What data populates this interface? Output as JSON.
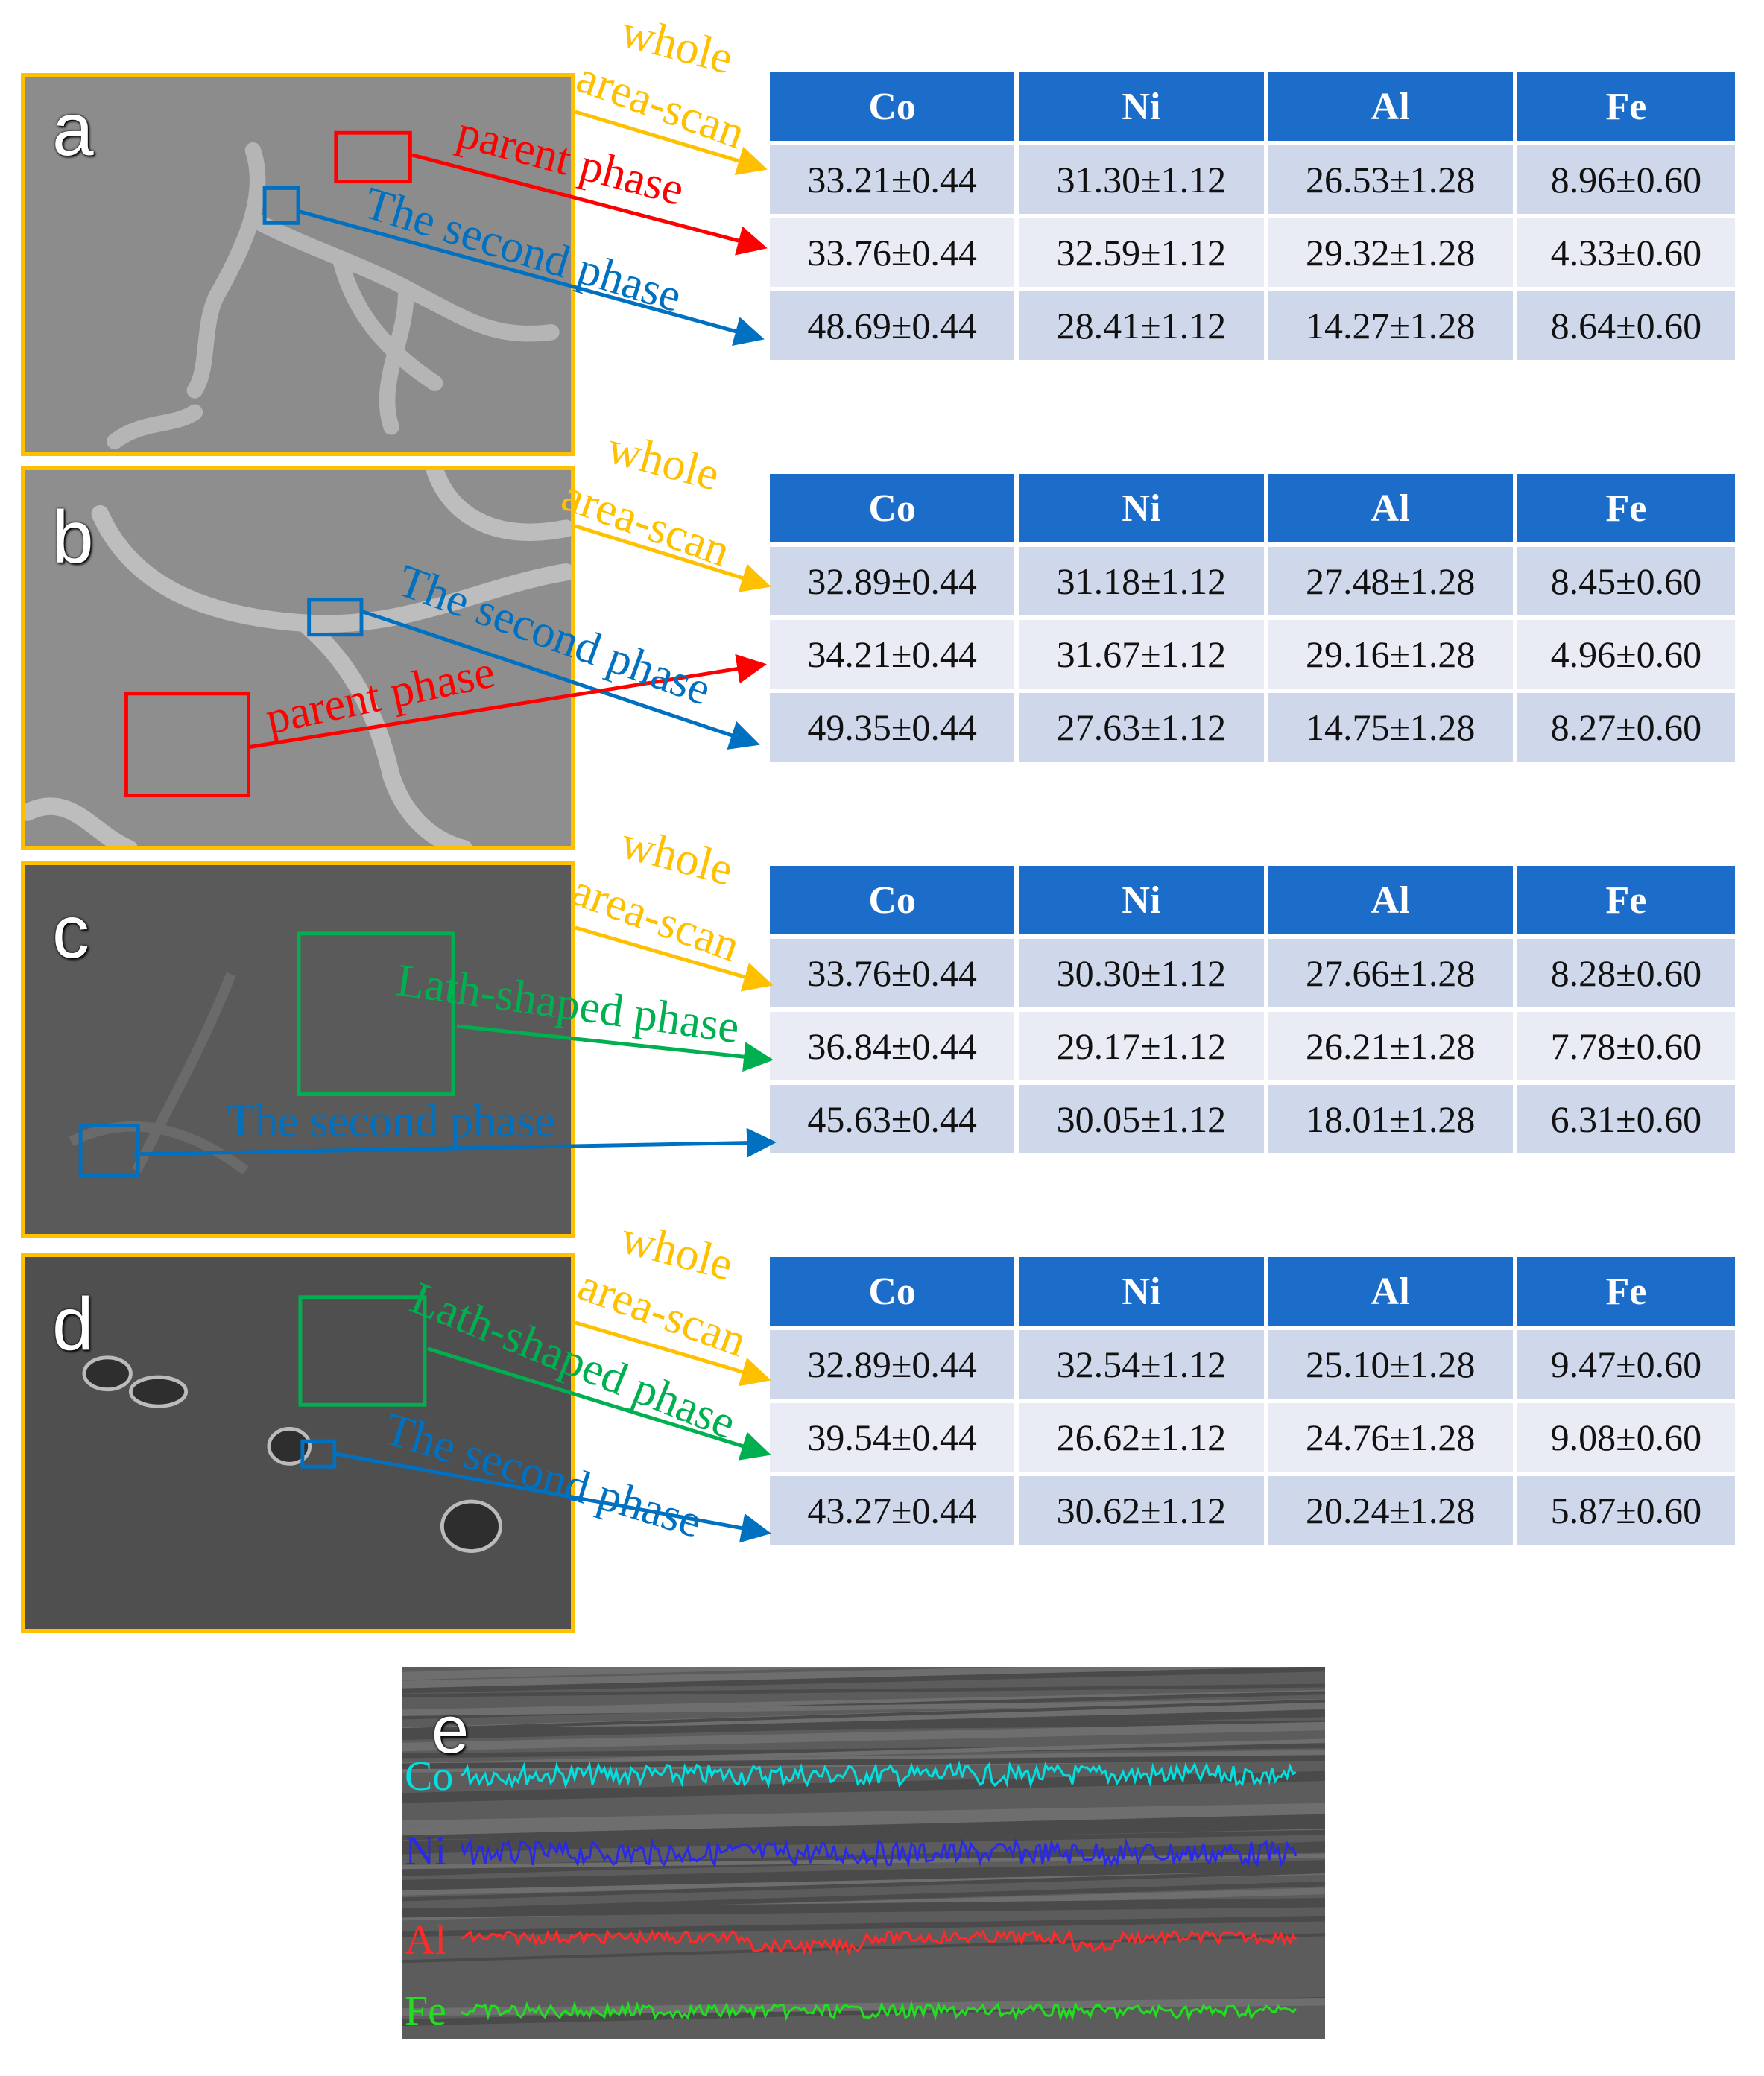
{
  "panels": [
    {
      "letter": "a",
      "whole": "whole",
      "area_scan": "area-scan",
      "phase1": "parent phase",
      "phase2": "The second phase"
    },
    {
      "letter": "b",
      "whole": "whole",
      "area_scan": "area-scan",
      "phase1": "parent phase",
      "phase2": "The second phase"
    },
    {
      "letter": "c",
      "whole": "whole",
      "area_scan": "area-scan",
      "phase1": "Lath-shaped phase",
      "phase2": "The second phase"
    },
    {
      "letter": "d",
      "whole": "whole",
      "area_scan": "area-scan",
      "phase1": "Lath-shaped phase",
      "phase2": "The second phase"
    }
  ],
  "tables": [
    {
      "headers": [
        "Co",
        "Ni",
        "Al",
        "Fe"
      ],
      "rows": [
        [
          "33.21±0.44",
          "31.30±1.12",
          "26.53±1.28",
          "8.96±0.60"
        ],
        [
          "33.76±0.44",
          "32.59±1.12",
          "29.32±1.28",
          "4.33±0.60"
        ],
        [
          "48.69±0.44",
          "28.41±1.12",
          "14.27±1.28",
          "8.64±0.60"
        ]
      ]
    },
    {
      "headers": [
        "Co",
        "Ni",
        "Al",
        "Fe"
      ],
      "rows": [
        [
          "32.89±0.44",
          "31.18±1.12",
          "27.48±1.28",
          "8.45±0.60"
        ],
        [
          "34.21±0.44",
          "31.67±1.12",
          "29.16±1.28",
          "4.96±0.60"
        ],
        [
          "49.35±0.44",
          "27.63±1.12",
          "14.75±1.28",
          "8.27±0.60"
        ]
      ]
    },
    {
      "headers": [
        "Co",
        "Ni",
        "Al",
        "Fe"
      ],
      "rows": [
        [
          "33.76±0.44",
          "30.30±1.12",
          "27.66±1.28",
          "8.28±0.60"
        ],
        [
          "36.84±0.44",
          "29.17±1.12",
          "26.21±1.28",
          "7.78±0.60"
        ],
        [
          "45.63±0.44",
          "30.05±1.12",
          "18.01±1.28",
          "6.31±0.60"
        ]
      ]
    },
    {
      "headers": [
        "Co",
        "Ni",
        "Al",
        "Fe"
      ],
      "rows": [
        [
          "32.89±0.44",
          "32.54±1.12",
          "25.10±1.28",
          "9.47±0.60"
        ],
        [
          "39.54±0.44",
          "26.62±1.12",
          "24.76±1.28",
          "9.08±0.60"
        ],
        [
          "43.27±0.44",
          "30.62±1.12",
          "20.24±1.28",
          "5.87±0.60"
        ]
      ]
    }
  ],
  "linescan": {
    "letter": "e",
    "elements": [
      {
        "label": "Co",
        "color": "#00E0E0"
      },
      {
        "label": "Ni",
        "color": "#2A2AE6"
      },
      {
        "label": "Al",
        "color": "#FF2A2A"
      },
      {
        "label": "Fe",
        "color": "#22DD22"
      }
    ]
  },
  "colors": {
    "whole": "#FFC000",
    "parent": "#FF0000",
    "second": "#0070C0",
    "lath": "#00B050",
    "header": "#1C6DC9"
  }
}
